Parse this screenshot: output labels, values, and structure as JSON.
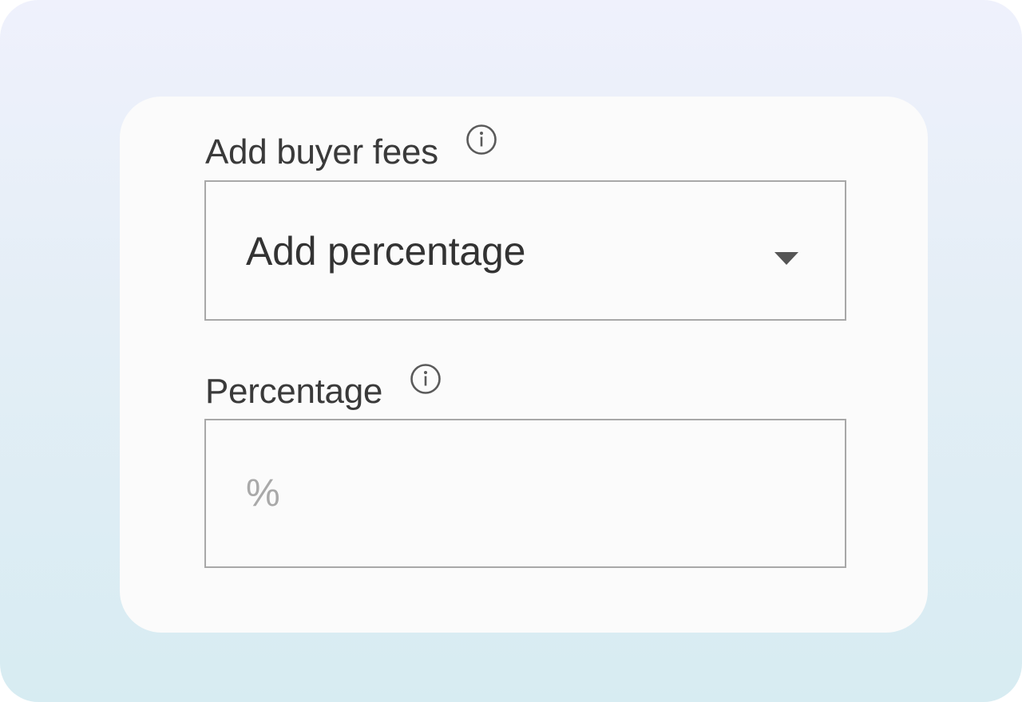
{
  "buyer_fees": {
    "label": "Add buyer fees",
    "info_icon": "info-circle-icon",
    "select": {
      "selected_value": "Add percentage",
      "dropdown_icon": "caret-down-icon"
    }
  },
  "percentage": {
    "label": "Percentage",
    "info_icon": "info-circle-icon",
    "input": {
      "value": "",
      "placeholder": "%"
    }
  },
  "colors": {
    "background_top": "#eff1fc",
    "background_bottom": "#d7ecf2",
    "card": "#fbfbfb",
    "border": "#a8a8a8",
    "text": "#333333",
    "placeholder": "#a9a9a9"
  }
}
